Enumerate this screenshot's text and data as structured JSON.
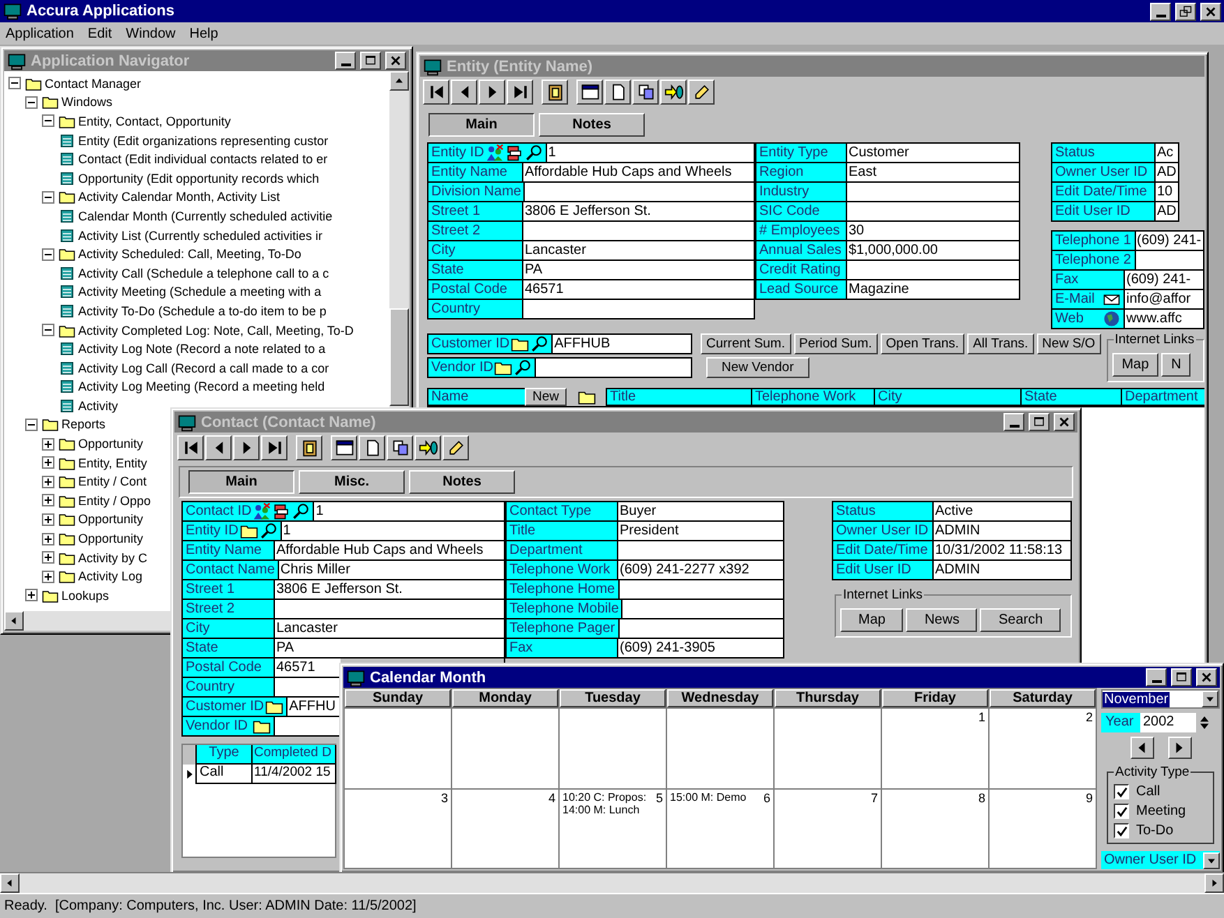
{
  "app": {
    "title": "Accura Applications"
  },
  "menu": [
    {
      "label": "Application"
    },
    {
      "label": "Edit"
    },
    {
      "label": "Window"
    },
    {
      "label": "Help"
    }
  ],
  "navigator": {
    "title": "Application Navigator",
    "tree": [
      {
        "label": "Contact Manager",
        "kind": "folder",
        "expanded": true,
        "children": [
          {
            "label": "Windows",
            "kind": "folder",
            "expanded": true,
            "children": [
              {
                "label": "Entity, Contact, Opportunity",
                "kind": "folder",
                "expanded": true,
                "children": [
                  {
                    "label": "Entity (Edit organizations representing custor",
                    "kind": "window"
                  },
                  {
                    "label": "Contact (Edit individual contacts related to er",
                    "kind": "window"
                  },
                  {
                    "label": "Opportunity (Edit opportunity records which",
                    "kind": "window"
                  }
                ]
              },
              {
                "label": "Activity Calendar Month, Activity List",
                "kind": "folder",
                "expanded": true,
                "children": [
                  {
                    "label": "Calendar Month (Currently scheduled activitie",
                    "kind": "window"
                  },
                  {
                    "label": "Activity List (Currently scheduled activities ir",
                    "kind": "window"
                  }
                ]
              },
              {
                "label": "Activity Scheduled: Call, Meeting, To-Do",
                "kind": "folder",
                "expanded": true,
                "children": [
                  {
                    "label": "Activity Call (Schedule a telephone call to a c",
                    "kind": "window"
                  },
                  {
                    "label": "Activity Meeting (Schedule a meeting with a",
                    "kind": "window"
                  },
                  {
                    "label": "Activity To-Do (Schedule a to-do item to be p",
                    "kind": "window"
                  }
                ]
              },
              {
                "label": "Activity Completed Log: Note, Call, Meeting, To-D",
                "kind": "folder",
                "expanded": true,
                "children": [
                  {
                    "label": "Activity Log Note (Record a note related to a",
                    "kind": "window"
                  },
                  {
                    "label": "Activity Log Call (Record a call made to a cor",
                    "kind": "window"
                  },
                  {
                    "label": "Activity Log Meeting (Record a meeting held",
                    "kind": "window"
                  },
                  {
                    "label": "Activity",
                    "kind": "window"
                  }
                ]
              }
            ]
          },
          {
            "label": "Reports",
            "kind": "folder",
            "expanded": true,
            "children": [
              {
                "label": "Opportunity",
                "kind": "folder",
                "expanded": false
              },
              {
                "label": "Entity, Entity",
                "kind": "folder",
                "expanded": false
              },
              {
                "label": "Entity / Cont",
                "kind": "folder",
                "expanded": false
              },
              {
                "label": "Entity / Oppo",
                "kind": "folder",
                "expanded": false
              },
              {
                "label": "Opportunity",
                "kind": "folder",
                "expanded": false
              },
              {
                "label": "Opportunity",
                "kind": "folder",
                "expanded": false
              },
              {
                "label": "Activity by C",
                "kind": "folder",
                "expanded": false
              },
              {
                "label": "Activity Log",
                "kind": "folder",
                "expanded": false
              }
            ]
          },
          {
            "label": "Lookups",
            "kind": "folder",
            "expanded": false
          }
        ]
      }
    ]
  },
  "entity": {
    "title": "Entity (Entity Name)",
    "tabs": [
      {
        "label": "Main",
        "selected": true
      },
      {
        "label": "Notes",
        "selected": false
      }
    ],
    "left": [
      {
        "label": "Entity ID",
        "kind": "id",
        "value": "1"
      },
      {
        "label": "Entity Name",
        "value": "Affordable Hub Caps and Wheels"
      },
      {
        "label": "Division Name"
      },
      {
        "label": "Street 1",
        "value": "3806 E Jefferson St."
      },
      {
        "label": "Street 2"
      },
      {
        "label": "City",
        "value": "Lancaster"
      },
      {
        "label": "State",
        "value": "PA"
      },
      {
        "label": "Postal Code",
        "value": "46571"
      },
      {
        "label": "Country"
      }
    ],
    "middle": [
      {
        "label": "Entity Type",
        "value": "Customer"
      },
      {
        "label": "Region",
        "value": "East"
      },
      {
        "label": "Industry"
      },
      {
        "label": "SIC Code"
      },
      {
        "label": "# Employees",
        "value": "30"
      },
      {
        "label": "Annual Sales",
        "value": "$1,000,000.00"
      },
      {
        "label": "Credit Rating"
      },
      {
        "label": "Lead Source",
        "value": "Magazine"
      }
    ],
    "status": [
      {
        "label": "Status",
        "value": "Ac"
      },
      {
        "label": "Owner User ID",
        "value": "AD"
      },
      {
        "label": "Edit Date/Time",
        "value": "10"
      },
      {
        "label": "Edit User ID",
        "value": "AD"
      }
    ],
    "phones": [
      {
        "label": "Telephone 1",
        "value": "(609) 241-"
      },
      {
        "label": "Telephone 2"
      },
      {
        "label": "Fax",
        "value": "(609) 241-"
      },
      {
        "label": "E-Mail",
        "kind": "mail",
        "value": "info@affor"
      },
      {
        "label": "Web",
        "kind": "web",
        "value": "www.affc"
      }
    ],
    "customer": {
      "label": "Customer ID",
      "kind": "link",
      "value": "AFFHUB"
    },
    "vendor": {
      "label": "Vendor ID",
      "kind": "link"
    },
    "summary_buttons": [
      {
        "label": "Current Sum."
      },
      {
        "label": "Period Sum."
      },
      {
        "label": "Open Trans."
      },
      {
        "label": "All Trans."
      },
      {
        "label": "New S/O"
      }
    ],
    "vendor_button": "New Vendor",
    "links": {
      "title": "Internet Links",
      "buttons": [
        {
          "label": "Map"
        },
        {
          "label": "N"
        }
      ]
    },
    "grid_header": [
      {
        "kind": "header",
        "text": "Name"
      },
      {
        "kind": "button",
        "text": "New"
      },
      {
        "kind": "icon"
      },
      {
        "kind": "header",
        "text": "Title"
      },
      {
        "kind": "header",
        "text": "Telephone Work"
      },
      {
        "kind": "header",
        "text": "City"
      },
      {
        "kind": "header",
        "text": "State"
      },
      {
        "kind": "header",
        "text": "Department"
      }
    ]
  },
  "contact": {
    "title": "Contact (Contact Name)",
    "tabs": [
      {
        "label": "Main",
        "selected": true
      },
      {
        "label": "Misc.",
        "selected": false
      },
      {
        "label": "Notes",
        "selected": false
      }
    ],
    "left": [
      {
        "label": "Contact ID",
        "kind": "id",
        "value": "1"
      },
      {
        "label": "Entity ID",
        "kind": "link",
        "value": "1"
      },
      {
        "label": "Entity Name",
        "value": "Affordable Hub Caps and Wheels"
      },
      {
        "label": "Contact Name",
        "value": "Chris Miller"
      },
      {
        "label": "Street 1",
        "value": "3806 E Jefferson St."
      },
      {
        "label": "Street 2"
      },
      {
        "label": "City",
        "value": "Lancaster"
      },
      {
        "label": "State",
        "value": "PA"
      },
      {
        "label": "Postal Code",
        "value": "46571"
      },
      {
        "label": "Country"
      },
      {
        "label": "Customer ID",
        "kind": "folder",
        "value": "AFFHU"
      },
      {
        "label": "Vendor ID",
        "kind": "folder"
      }
    ],
    "middle": [
      {
        "label": "Contact Type",
        "value": "Buyer"
      },
      {
        "label": "Title",
        "value": "President"
      },
      {
        "label": "Department"
      },
      {
        "label": "Telephone Work",
        "value": "(609) 241-2277 x392"
      },
      {
        "label": "Telephone Home"
      },
      {
        "label": "Telephone Mobile"
      },
      {
        "label": "Telephone Pager"
      },
      {
        "label": "Fax",
        "value": "(609) 241-3905"
      }
    ],
    "right": [
      {
        "label": "Status",
        "value": "Active"
      },
      {
        "label": "Owner User ID",
        "value": "ADMIN"
      },
      {
        "label": "Edit Date/Time",
        "value": "10/31/2002 11:58:13"
      },
      {
        "label": "Edit User ID",
        "value": "ADMIN"
      }
    ],
    "links": {
      "title": "Internet Links",
      "buttons": [
        {
          "label": "Map"
        },
        {
          "label": "News"
        },
        {
          "label": "Search"
        }
      ]
    },
    "activities": {
      "columns": [
        "Type",
        "Completed D"
      ],
      "rows": [
        {
          "cells": [
            "Call",
            "11/4/2002 15"
          ],
          "selected": true
        }
      ]
    }
  },
  "calendar": {
    "title": "Calendar Month",
    "days": [
      "Sunday",
      "Monday",
      "Tuesday",
      "Wednesday",
      "Thursday",
      "Friday",
      "Saturday"
    ],
    "weeks": [
      [
        {
          "day": "1"
        },
        {
          "day": "2"
        }
      ],
      [
        {
          "day": "3"
        },
        {
          "day": "4"
        },
        {
          "day": "5",
          "entries": [
            "10:20 C: Propos:",
            "14:00 M: Lunch"
          ]
        },
        {
          "day": "6",
          "entries": [
            "15:00 M: Demo"
          ]
        },
        {
          "day": "7"
        },
        {
          "day": "8"
        },
        {
          "day": "9"
        }
      ]
    ],
    "month": "November",
    "year_label": "Year",
    "year": "2002",
    "activity_types": {
      "title": "Activity Type",
      "items": [
        {
          "label": "Call",
          "checked": true
        },
        {
          "label": "Meeting",
          "checked": true
        },
        {
          "label": "To-Do",
          "checked": true
        }
      ]
    },
    "owner_label": "Owner User ID"
  },
  "status_bar": "Ready.  [Company: Computers, Inc. User: ADMIN Date: 11/5/2002]"
}
